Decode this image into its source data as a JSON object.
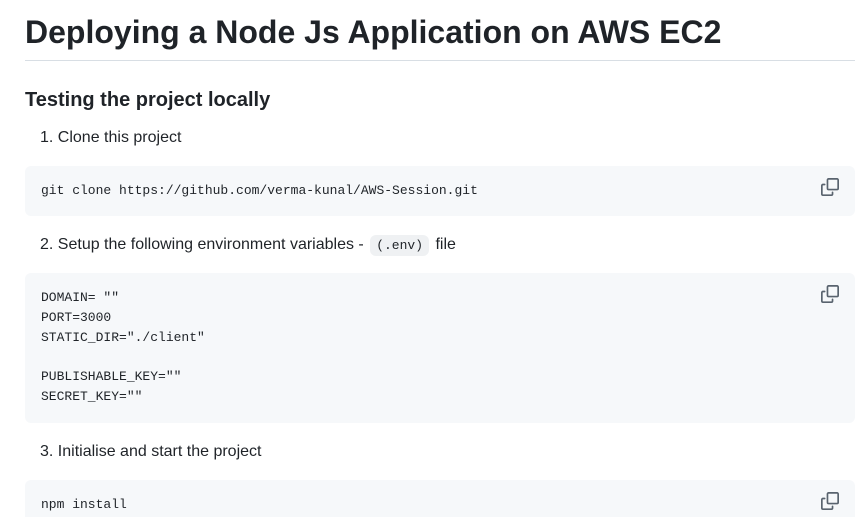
{
  "title": "Deploying a Node Js Application on AWS EC2",
  "section_heading": "Testing the project locally",
  "steps": [
    {
      "number": "1.",
      "text": "Clone this project",
      "code_lines": [
        "git clone https://github.com/verma-kunal/AWS-Session.git"
      ]
    },
    {
      "number": "2.",
      "text_before": "Setup the following environment variables -",
      "inline_code": "(.env)",
      "text_after": "file",
      "code_lines": [
        "DOMAIN= \"\"",
        "PORT=3000",
        "STATIC_DIR=\"./client\"",
        "",
        "PUBLISHABLE_KEY=\"\"",
        "SECRET_KEY=\"\""
      ]
    },
    {
      "number": "3.",
      "text": "Initialise and start the project",
      "code_lines": [
        "npm install"
      ]
    }
  ],
  "icons": {
    "copy": "copy-icon"
  }
}
